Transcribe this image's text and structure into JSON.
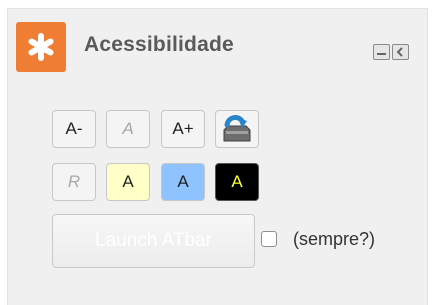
{
  "widget": {
    "title": "Acessibilidade",
    "header_icon": "asterisk-icon",
    "controls": {
      "minimize_icon": "minimize-icon",
      "collapse_icon": "collapse-left-icon"
    }
  },
  "toolbar": {
    "row1": [
      {
        "label": "A-",
        "state": "enabled"
      },
      {
        "label": "A",
        "state": "disabled"
      },
      {
        "label": "A+",
        "state": "enabled"
      },
      {
        "icon": "reset-tray-icon"
      }
    ],
    "row2": [
      {
        "label": "R",
        "state": "disabled"
      },
      {
        "label": "A",
        "color": "#ffffc8"
      },
      {
        "label": "A",
        "color": "#8ec3ff"
      },
      {
        "label": "A",
        "color": "#000000",
        "text_color": "#ffff33"
      }
    ]
  },
  "launch": {
    "label": "Launch ATbar"
  },
  "always": {
    "label": "(sempre?)",
    "checked": false
  },
  "colors": {
    "accent": "#ef7d33",
    "panel": "#f0f0f0",
    "title": "#5a5a5a"
  }
}
